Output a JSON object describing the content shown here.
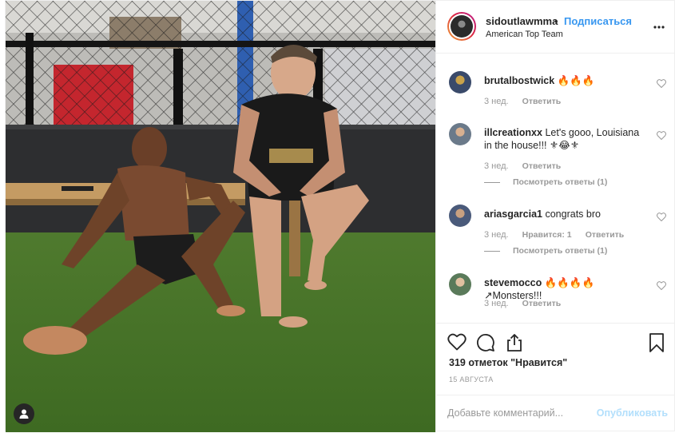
{
  "post": {
    "header": {
      "username": "sidoutlawmma",
      "separator": "•",
      "follow_label": "Подписаться",
      "location": "American Top Team"
    },
    "comments": [
      {
        "username": "brutalbostwick",
        "text": "🔥🔥🔥",
        "time": "3 нед.",
        "reply_label": "Ответить",
        "avatar_color": "#3a4a6a"
      },
      {
        "username": "illcreationxx",
        "text": "Let's gooo, Louisiana in the house!!! ⚜😂⚜",
        "time": "3 нед.",
        "reply_label": "Ответить",
        "view_replies": "Посмотреть ответы (1)",
        "avatar_color": "#6b7a8a"
      },
      {
        "username": "ariasgarcia1",
        "text": "congrats bro",
        "time": "3 нед.",
        "likes_label": "Нравится: 1",
        "reply_label": "Ответить",
        "view_replies": "Посмотреть ответы (1)",
        "avatar_color": "#4a5a7a"
      },
      {
        "username": "stevemocco",
        "text": "🔥🔥🔥🔥↗Monsters!!!",
        "time": "3 нед.",
        "reply_label": "Ответить",
        "avatar_color": "#5a7a5a"
      }
    ],
    "actions": {
      "likes": "319 отметок \"Нравится\"",
      "date": "15 АВГУСТА"
    },
    "add_comment": {
      "placeholder": "Добавьте комментарий...",
      "publish_label": "Опубликовать"
    },
    "icons": {
      "like": "heart-icon",
      "comment": "comment-icon",
      "share": "share-icon",
      "save": "bookmark-icon",
      "more": "more-dots-icon",
      "tag": "user-tag-icon"
    },
    "colors": {
      "link": "#3897f0",
      "publish_disabled": "#b2dffc",
      "muted": "#999999"
    }
  }
}
